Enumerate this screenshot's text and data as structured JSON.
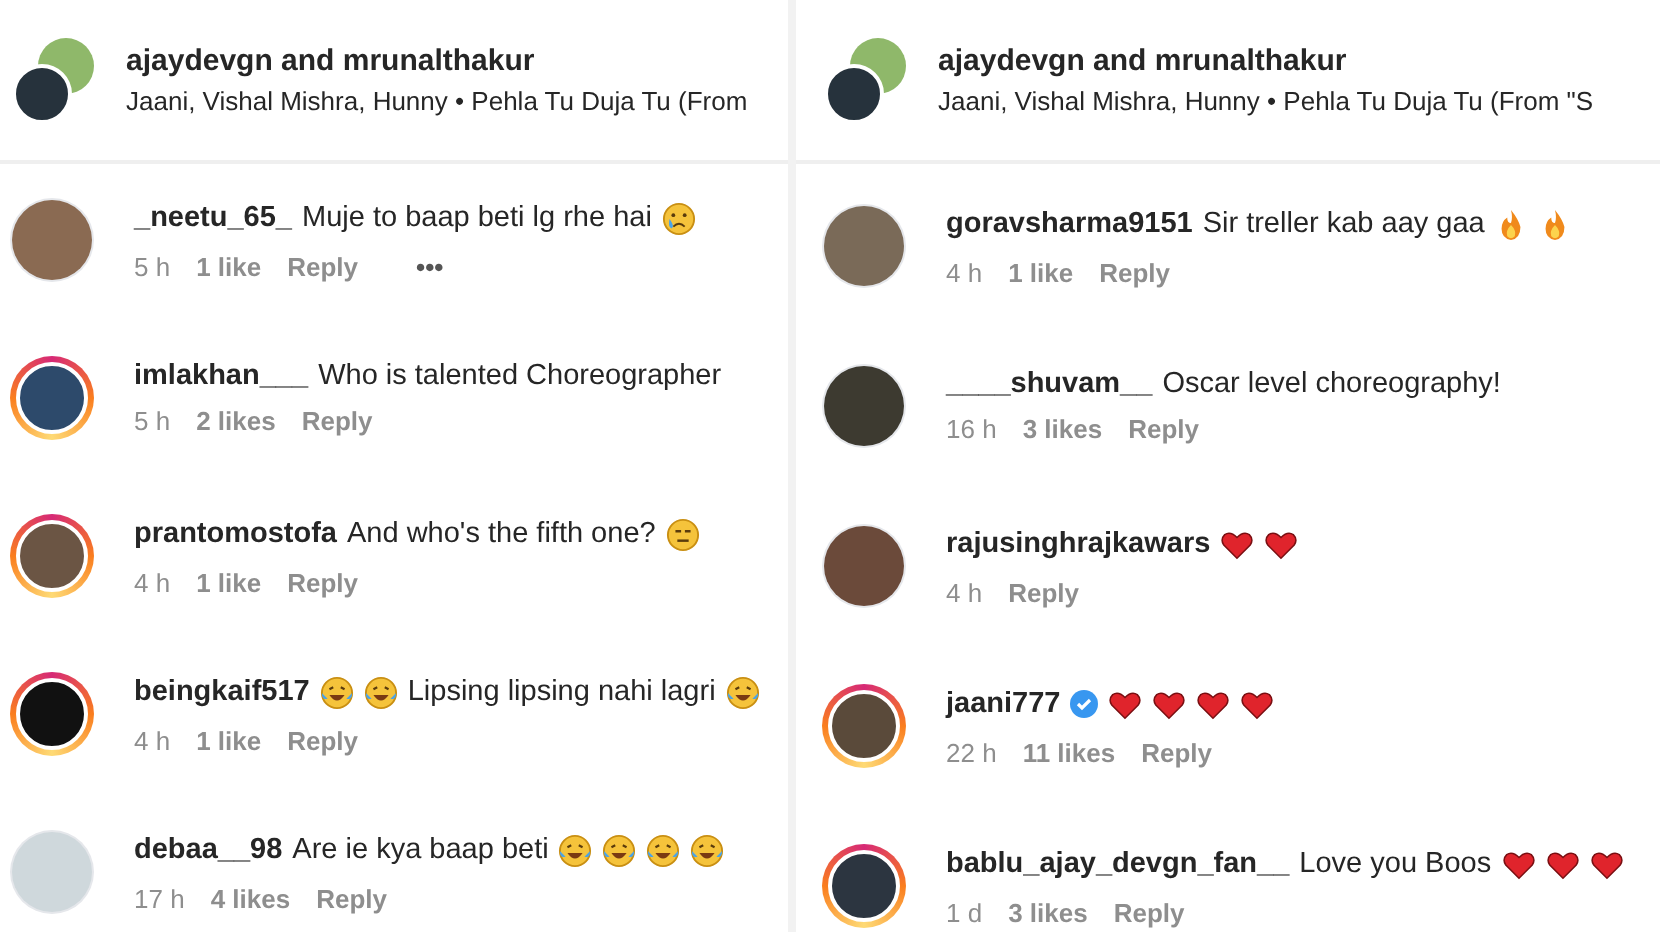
{
  "panels": [
    {
      "header": {
        "title": "ajaydevgn and mrunalthakur",
        "subtitle": "Jaani, Vishal Mishra, Hunny • Pehla Tu Duja Tu (From"
      },
      "comments": [
        {
          "username": "_neetu_65_",
          "story_ring": false,
          "verified": false,
          "parts": [
            {
              "kind": "text",
              "text": "Muje to baap beti lg rhe hai"
            },
            {
              "kind": "sad_emoji"
            }
          ],
          "time": "5 h",
          "likes": "1 like",
          "reply": "Reply",
          "more": "•••"
        },
        {
          "username": "imlakhan___",
          "story_ring": true,
          "verified": false,
          "parts": [
            {
              "kind": "text",
              "text": "Who is talented Choreographer"
            }
          ],
          "time": "5 h",
          "likes": "2 likes",
          "reply": "Reply"
        },
        {
          "username": "prantomostofa",
          "story_ring": true,
          "verified": false,
          "parts": [
            {
              "kind": "text",
              "text": "And who's the fifth one?"
            },
            {
              "kind": "neutral_emoji"
            }
          ],
          "time": "4 h",
          "likes": "1 like",
          "reply": "Reply"
        },
        {
          "username": "beingkaif517",
          "story_ring": true,
          "verified": false,
          "parts": [
            {
              "kind": "laugh_emoji"
            },
            {
              "kind": "laugh_emoji"
            },
            {
              "kind": "text",
              "text": "Lipsing lipsing nahi lagri"
            },
            {
              "kind": "laugh_emoji"
            }
          ],
          "time": "4 h",
          "likes": "1 like",
          "reply": "Reply"
        },
        {
          "username": "debaa__98",
          "story_ring": false,
          "verified": false,
          "parts": [
            {
              "kind": "text",
              "text": "Are ie kya baap beti"
            },
            {
              "kind": "laugh_emoji"
            },
            {
              "kind": "laugh_emoji"
            },
            {
              "kind": "laugh_emoji"
            },
            {
              "kind": "laugh_emoji"
            }
          ],
          "time": "17 h",
          "likes": "4 likes",
          "reply": "Reply"
        }
      ]
    },
    {
      "header": {
        "title": "ajaydevgn and mrunalthakur",
        "subtitle": "Jaani, Vishal Mishra, Hunny • Pehla Tu Duja Tu (From \"S"
      },
      "comments": [
        {
          "username": "goravsharma9151",
          "story_ring": false,
          "verified": false,
          "parts": [
            {
              "kind": "text",
              "text": "Sir treller kab aay gaa"
            },
            {
              "kind": "fire_emoji"
            },
            {
              "kind": "fire_emoji"
            }
          ],
          "time": "4 h",
          "likes": "1 like",
          "reply": "Reply"
        },
        {
          "username": "____shuvam__",
          "story_ring": false,
          "verified": false,
          "parts": [
            {
              "kind": "text",
              "text": "Oscar level choreography!"
            }
          ],
          "time": "16 h",
          "likes": "3 likes",
          "reply": "Reply"
        },
        {
          "username": "rajusinghrajkawars",
          "story_ring": false,
          "verified": false,
          "parts": [
            {
              "kind": "heart_emoji"
            },
            {
              "kind": "heart_emoji"
            }
          ],
          "time": "4 h",
          "reply": "Reply"
        },
        {
          "username": "jaani777",
          "story_ring": true,
          "verified": true,
          "parts": [
            {
              "kind": "heart_emoji"
            },
            {
              "kind": "heart_emoji"
            },
            {
              "kind": "heart_emoji"
            },
            {
              "kind": "heart_emoji"
            }
          ],
          "time": "22 h",
          "likes": "11 likes",
          "reply": "Reply"
        },
        {
          "username": "bablu_ajay_devgn_fan__",
          "story_ring": true,
          "verified": false,
          "parts": [
            {
              "kind": "text",
              "text": "Love you Boos"
            },
            {
              "kind": "heart_emoji"
            },
            {
              "kind": "heart_emoji"
            },
            {
              "kind": "heart_emoji"
            }
          ],
          "time": "1 d",
          "likes": "3 likes",
          "reply": "Reply"
        }
      ]
    }
  ]
}
